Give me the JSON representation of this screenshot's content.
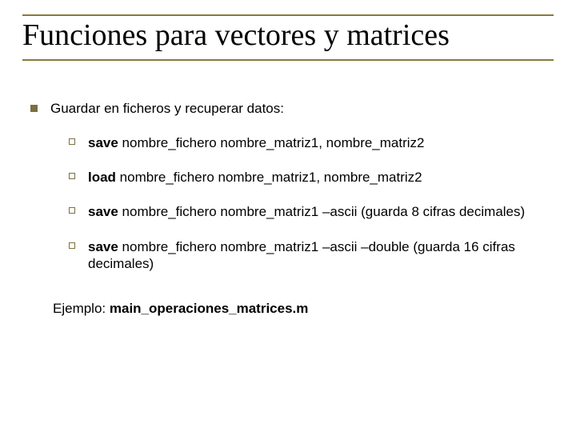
{
  "title": "Funciones para vectores y matrices",
  "intro": "Guardar en ficheros y recuperar datos:",
  "items": [
    {
      "cmd": "save",
      "rest": " nombre_fichero nombre_matriz1, nombre_matriz2"
    },
    {
      "cmd": "load",
      "rest": " nombre_fichero nombre_matriz1, nombre_matriz2"
    },
    {
      "cmd": "save",
      "rest": " nombre_fichero nombre_matriz1 –ascii (guarda 8 cifras decimales)"
    },
    {
      "cmd": "save",
      "rest": " nombre_fichero nombre_matriz1 –ascii –double (guarda 16 cifras decimales)"
    }
  ],
  "example_label": "Ejemplo: ",
  "example_file": "main_operaciones_matrices.m"
}
